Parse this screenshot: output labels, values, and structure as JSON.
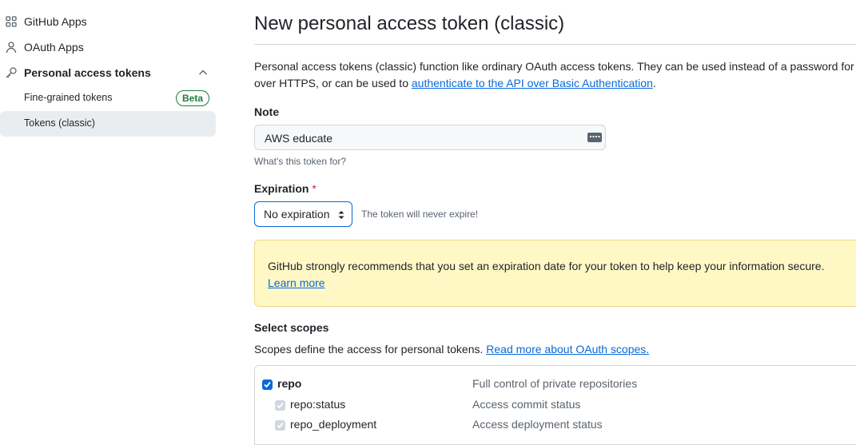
{
  "sidebar": {
    "items": [
      {
        "label": "GitHub Apps",
        "icon": "apps-grid-icon"
      },
      {
        "label": "OAuth Apps",
        "icon": "person-icon"
      },
      {
        "label": "Personal access tokens",
        "icon": "key-icon"
      }
    ],
    "sub_items": [
      {
        "label": "Fine-grained tokens",
        "badge": "Beta"
      },
      {
        "label": "Tokens (classic)"
      }
    ]
  },
  "main": {
    "title": "New personal access token (classic)",
    "intro_line1": "Personal access tokens (classic) function like ordinary OAuth access tokens. They can be used instead of a password for Git",
    "intro_line2_prefix": "over HTTPS, or can be used to ",
    "intro_link": "authenticate to the API over Basic Authentication",
    "intro_suffix": ".",
    "note": {
      "label": "Note",
      "value": "AWS educate",
      "hint": "What's this token for?"
    },
    "expiration": {
      "label": "Expiration",
      "required_mark": "*",
      "selected": "No expiration",
      "message": "The token will never expire!"
    },
    "warning": {
      "text": "GitHub strongly recommends that you set an expiration date for your token to help keep your information secure.",
      "link": "Learn more"
    },
    "scopes": {
      "label": "Select scopes",
      "description": "Scopes define the access for personal tokens. ",
      "description_link": "Read more about OAuth scopes.",
      "rows": [
        {
          "name": "repo",
          "description": "Full control of private repositories",
          "checked": true
        },
        {
          "name": "repo:status",
          "description": "Access commit status",
          "checked": true
        },
        {
          "name": "repo_deployment",
          "description": "Access deployment status",
          "checked": true
        }
      ]
    }
  },
  "colors": {
    "accent": "#0969da",
    "success": "#1a7f37",
    "danger": "#cf222e",
    "warning_bg": "#fff8c5"
  }
}
